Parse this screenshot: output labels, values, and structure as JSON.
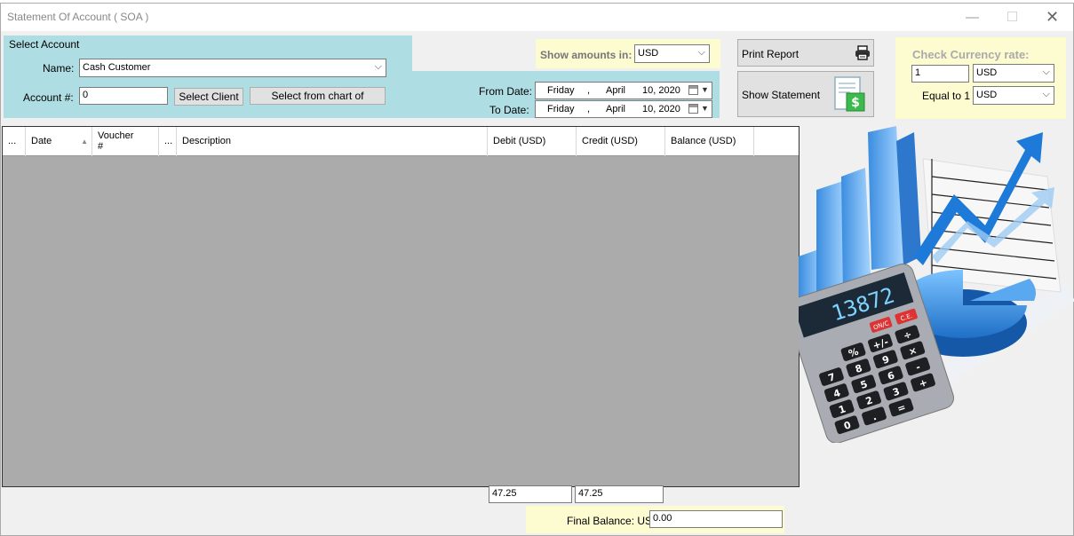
{
  "window": {
    "title": "Statement Of Account ( SOA )",
    "min": "—",
    "max": "☐",
    "close": "✕"
  },
  "account": {
    "section_label": "Select Account",
    "name_label": "Name:",
    "name_value": "Cash Customer",
    "account_label": "Account #:",
    "account_value": "0",
    "select_client": "Select Client",
    "select_chart": "Select from chart of"
  },
  "show_amounts": {
    "label": "Show amounts in:",
    "value": "USD"
  },
  "dates": {
    "from_label": "From Date:",
    "to_label": "To Date:",
    "from": {
      "day": "Friday",
      "sep": ",",
      "month": "April",
      "date": "10, 2020"
    },
    "to": {
      "day": "Friday",
      "sep": ",",
      "month": "April",
      "date": "10, 2020"
    }
  },
  "actions": {
    "print_report": "Print Report",
    "show_statement": "Show Statement"
  },
  "currency_rate": {
    "title": "Check Currency rate:",
    "amount": "1",
    "from_currency": "USD",
    "equal_label": "Equal to 1",
    "to_currency": "USD"
  },
  "grid": {
    "columns": {
      "c1": "...",
      "date": "Date",
      "voucher_line1": "Voucher",
      "voucher_line2": "#",
      "c4": "...",
      "description": "Description",
      "debit": "Debit (USD)",
      "credit": "Credit (USD)",
      "balance": "Balance (USD)"
    }
  },
  "totals": {
    "debit": "47.25",
    "credit": "47.25",
    "final_label": "Final Balance: USD",
    "final_value": "0.00"
  },
  "illustration": {
    "calculator_display": "13872",
    "key_onc": "ON/C",
    "key_ce": "C.E.",
    "keys": [
      "%",
      "+/-",
      "÷",
      "7",
      "8",
      "9",
      "×",
      "4",
      "5",
      "6",
      "-",
      "1",
      "2",
      "3",
      "+",
      "0",
      ".",
      "="
    ]
  },
  "colors": {
    "panel_blue": "#aedde3",
    "panel_yellow": "#fdfbd0",
    "grid_bg": "#ababab"
  }
}
